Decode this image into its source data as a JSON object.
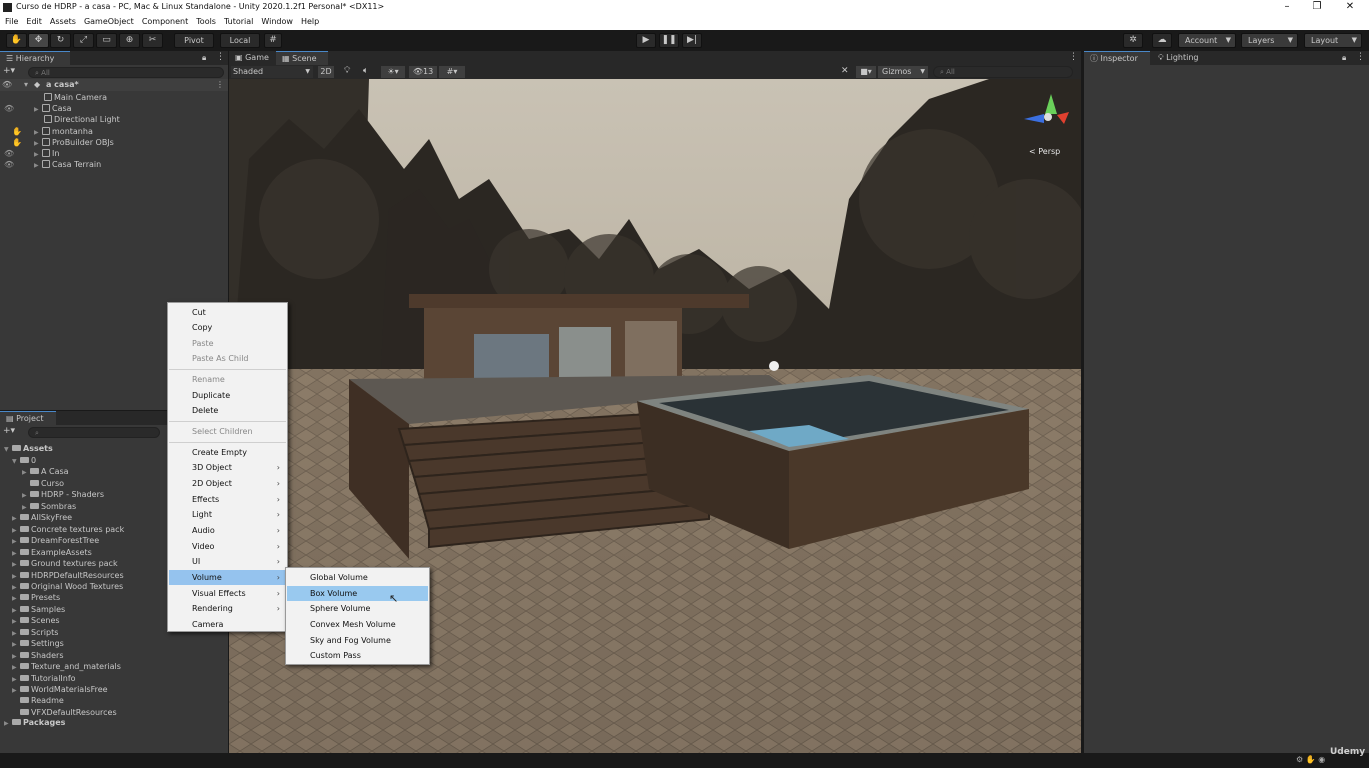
{
  "window": {
    "title": "Curso de HDRP - a casa - PC, Mac & Linux Standalone - Unity 2020.1.2f1 Personal* <DX11>",
    "minimize": "–",
    "maximize": "❐",
    "close": "✕"
  },
  "menubar": [
    "File",
    "Edit",
    "Assets",
    "GameObject",
    "Component",
    "Tools",
    "Tutorial",
    "Window",
    "Help"
  ],
  "toolbar": {
    "pivot": "Pivot",
    "local": "Local",
    "account": "Account",
    "layers": "Layers",
    "layout": "Layout"
  },
  "hierarchy": {
    "tab": "Hierarchy",
    "search_placeholder": "All",
    "scene_name": "a casa*",
    "items": [
      "Main Camera",
      "Casa",
      "Directional Light",
      "montanha",
      "ProBuilder OBJs",
      "In",
      "Casa Terrain"
    ]
  },
  "project": {
    "tab": "Project",
    "root": "Assets",
    "items": [
      {
        "label": "0",
        "level": 1
      },
      {
        "label": "A Casa",
        "level": 2
      },
      {
        "label": "Curso",
        "level": 2
      },
      {
        "label": "HDRP - Shaders",
        "level": 2
      },
      {
        "label": "Sombras",
        "level": 2
      },
      {
        "label": "AllSkyFree",
        "level": 1
      },
      {
        "label": "Concrete textures pack",
        "level": 1
      },
      {
        "label": "DreamForestTree",
        "level": 1
      },
      {
        "label": "ExampleAssets",
        "level": 1
      },
      {
        "label": "Ground textures pack",
        "level": 1
      },
      {
        "label": "HDRPDefaultResources",
        "level": 1
      },
      {
        "label": "Original Wood Textures",
        "level": 1
      },
      {
        "label": "Presets",
        "level": 1
      },
      {
        "label": "Samples",
        "level": 1
      },
      {
        "label": "Scenes",
        "level": 1
      },
      {
        "label": "Scripts",
        "level": 1
      },
      {
        "label": "Settings",
        "level": 1
      },
      {
        "label": "Shaders",
        "level": 1
      },
      {
        "label": "Texture_and_materials",
        "level": 1
      },
      {
        "label": "TutorialInfo",
        "level": 1
      },
      {
        "label": "WorldMaterialsFree",
        "level": 1
      },
      {
        "label": "Readme",
        "level": 1
      },
      {
        "label": "VFXDefaultResources",
        "level": 1
      }
    ],
    "packages": "Packages"
  },
  "scene_tabs": {
    "game": "Game",
    "scene": "Scene"
  },
  "scene_toolbar": {
    "shading": "Shaded",
    "mode_2d": "2D",
    "hidden_count": "13",
    "gizmos": "Gizmos",
    "search_placeholder": "All",
    "persp": "< Persp"
  },
  "inspector": {
    "tab": "Inspector",
    "lighting_tab": "Lighting"
  },
  "context_menu": {
    "items": [
      "Cut",
      "Copy",
      "Paste",
      "Paste As Child",
      "Rename",
      "Duplicate",
      "Delete",
      "Select Children",
      "Create Empty",
      "3D Object",
      "2D Object",
      "Effects",
      "Light",
      "Audio",
      "Video",
      "UI",
      "Volume",
      "Visual Effects",
      "Rendering",
      "Camera"
    ],
    "submenu_arrow": "›"
  },
  "volume_submenu": {
    "items": [
      "Global Volume",
      "Box Volume",
      "Sphere Volume",
      "Convex Mesh Volume",
      "Sky and Fog Volume",
      "Custom Pass"
    ]
  },
  "watermark": "Udemy",
  "colors": {
    "accent": "#4a88c8",
    "menu_highlight": "#95c3ee",
    "editor_bg": "#383838"
  }
}
